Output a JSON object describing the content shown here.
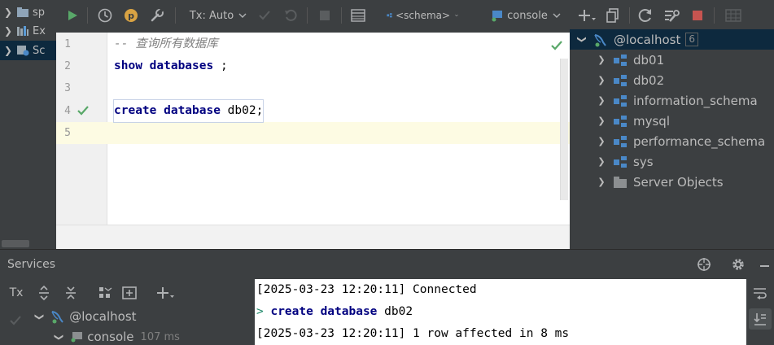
{
  "left_panel": {
    "rows": [
      {
        "label": "sp",
        "icon": "folder-icon",
        "selected": false
      },
      {
        "label": "Ex",
        "icon": "library-icon",
        "selected": false
      },
      {
        "label": "Sc",
        "icon": "scratches-icon",
        "selected": true
      }
    ]
  },
  "toolbar": {
    "tx_label": "Tx: Auto",
    "schema_label": "<schema>",
    "console_label": "console",
    "colors": {
      "run": "#59a869",
      "commit_icon": "#d9a343",
      "stop": "#c75450"
    }
  },
  "editor": {
    "line_numbers": [
      "1",
      "2",
      "3",
      "4",
      "5"
    ],
    "line1_comment": "-- 查询所有数据库",
    "line2_kw": "show databases",
    "line2_rest": " ;",
    "line4_kw": "create database",
    "line4_rest": " db02;",
    "status": "ok"
  },
  "db_tree": {
    "root_label": "@localhost",
    "root_count": "6",
    "items": [
      {
        "label": "db01",
        "icon": "schema-icon"
      },
      {
        "label": "db02",
        "icon": "schema-icon"
      },
      {
        "label": "information_schema",
        "icon": "schema-icon"
      },
      {
        "label": "mysql",
        "icon": "schema-icon"
      },
      {
        "label": "performance_schema",
        "icon": "schema-icon"
      },
      {
        "label": "sys",
        "icon": "schema-icon"
      },
      {
        "label": "Server Objects",
        "icon": "folder-icon"
      }
    ]
  },
  "services": {
    "title": "Services",
    "tx_label": "Tx",
    "tree_root": "@localhost",
    "tree_console": "console",
    "tree_console_time": "107 ms",
    "output": {
      "line1": "[2025-03-23 12:20:11] Connected",
      "line2_prompt": ">",
      "line2_kw": "create database",
      "line2_rest": " db02",
      "line3": "[2025-03-23 12:20:11] 1 row affected in 8 ms"
    }
  }
}
